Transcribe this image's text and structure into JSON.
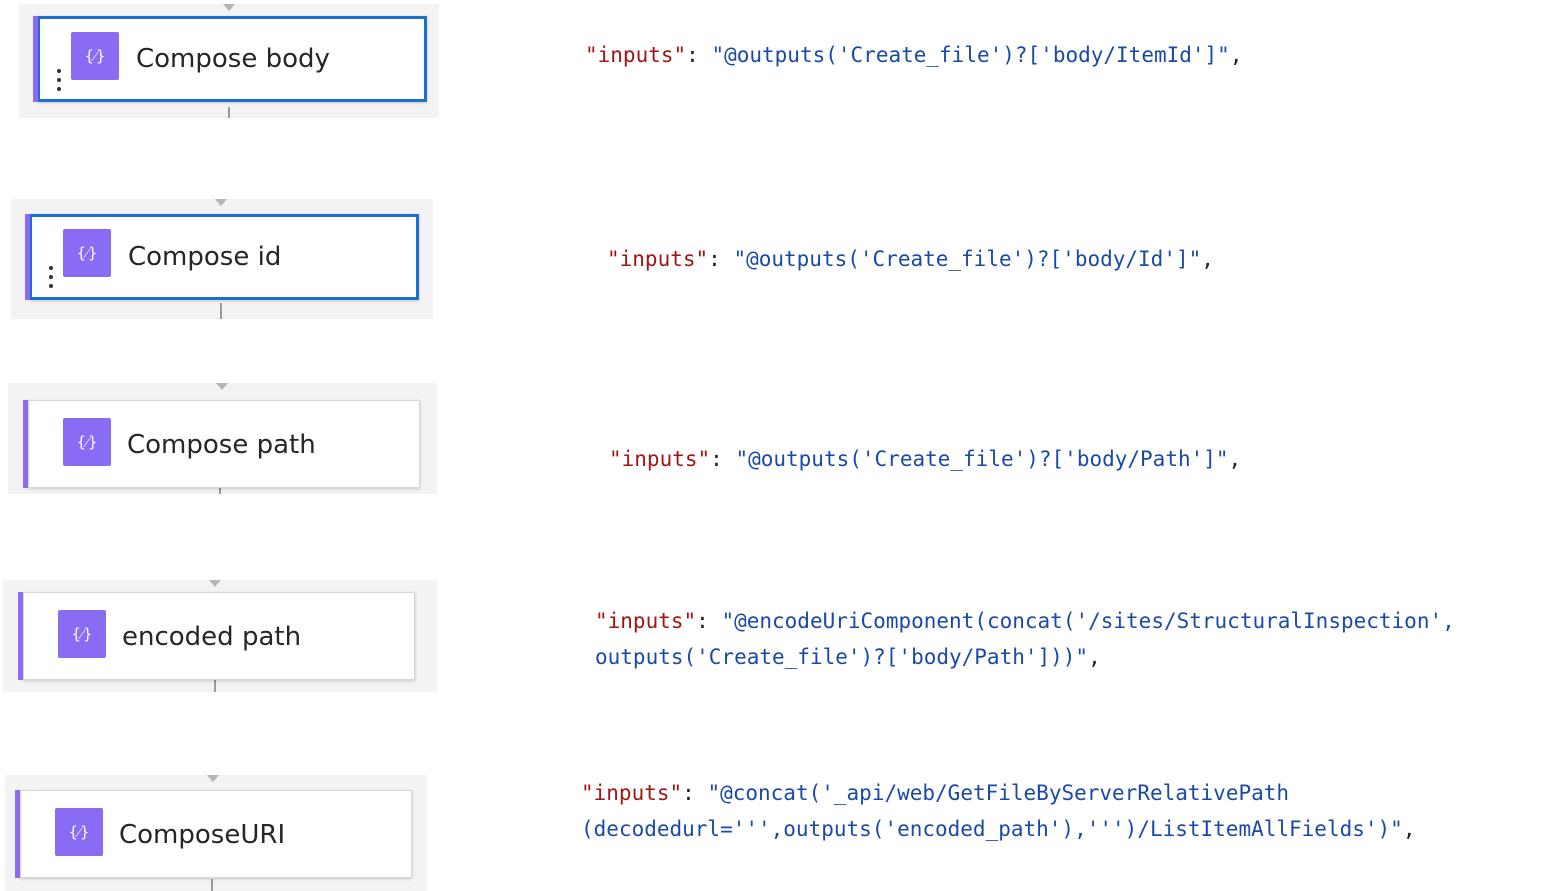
{
  "colors": {
    "accent": "#8c6bf0",
    "icon_bg": "#8a6bf4",
    "selected_border": "#1a6fd1",
    "json_key": "#a31515",
    "json_value": "#1a4aa8"
  },
  "actions": [
    {
      "title": "Compose body",
      "icon": "compose-braces-icon",
      "selected": true,
      "code_key": "\"inputs\"",
      "code_lines": [
        "\"@outputs('Create_file')?['body/ItemId']\""
      ]
    },
    {
      "title": "Compose id",
      "icon": "compose-braces-icon",
      "selected": true,
      "code_key": "\"inputs\"",
      "code_lines": [
        "\"@outputs('Create_file')?['body/Id']\""
      ]
    },
    {
      "title": "Compose path",
      "icon": "compose-braces-icon",
      "selected": false,
      "code_key": "\"inputs\"",
      "code_lines": [
        "\"@outputs('Create_file')?['body/Path']\""
      ]
    },
    {
      "title": "encoded path",
      "icon": "compose-braces-icon",
      "selected": false,
      "code_key": "\"inputs\"",
      "code_lines": [
        "\"@encodeUriComponent(concat('/sites/StructuralInspection',",
        "outputs('Create_file')?['body/Path']))\""
      ]
    },
    {
      "title": "ComposeURI",
      "icon": "compose-braces-icon",
      "selected": false,
      "code_key": "\"inputs\"",
      "code_lines": [
        "\"@concat('_api/web/GetFileByServerRelativePath",
        "(decodedurl=''',outputs('encoded_path'),''')/ListItemAllFields')\""
      ]
    }
  ],
  "punctuation": {
    "colon": ": ",
    "comma": ","
  }
}
